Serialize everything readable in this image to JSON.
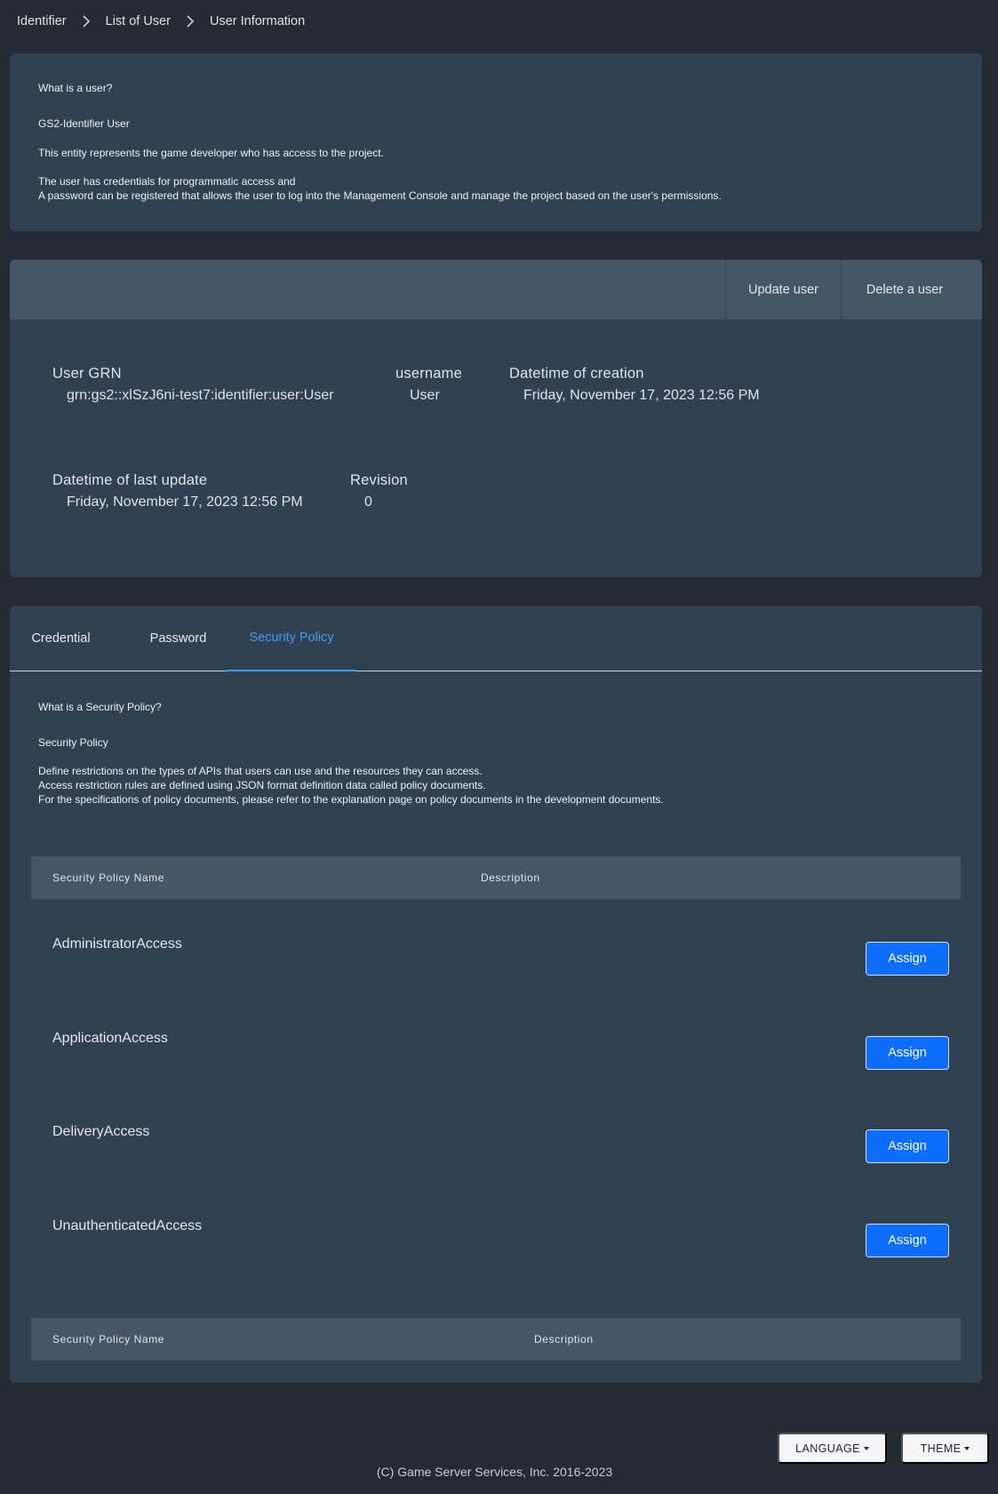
{
  "breadcrumb": {
    "items": [
      "Identifier",
      "List of User",
      "User Information"
    ]
  },
  "user_help": {
    "title": "What is a user?",
    "subtitle": "GS2-Identifier User",
    "p1": "This entity represents the game developer who has access to the project.",
    "p2_line1": "The user has credentials for programmatic access and",
    "p2_line2": "A password can be registered that allows the user to log into the Management Console and manage the project based on the user's permissions."
  },
  "toolbar": {
    "update_label": "Update user",
    "delete_label": "Delete a user"
  },
  "user": {
    "grn_label": "User GRN",
    "grn_value": "grn:gs2::xlSzJ6ni-test7:identifier:user:User",
    "username_label": "username",
    "username_value": "User",
    "created_label": "Datetime of creation",
    "created_value": "Friday, November 17, 2023 12:56 PM",
    "updated_label": "Datetime of last update",
    "updated_value": "Friday, November 17, 2023 12:56 PM",
    "revision_label": "Revision",
    "revision_value": "0"
  },
  "tabs": [
    {
      "label": "Credential",
      "active": false
    },
    {
      "label": "Password",
      "active": false
    },
    {
      "label": "Security Policy",
      "active": true
    }
  ],
  "policy_help": {
    "title": "What is a Security Policy?",
    "subtitle": "Security Policy",
    "line1": "Define restrictions on the types of APIs that users can use and the resources they can access.",
    "line2": "Access restriction rules are defined using JSON format definition data called policy documents.",
    "line3": "For the specifications of policy documents, please refer to the explanation page on policy documents in the development documents."
  },
  "policy_table": {
    "col_name": "Security Policy Name",
    "col_description": "Description",
    "assign_label": "Assign",
    "rows": [
      {
        "name": "AdministratorAccess",
        "description": ""
      },
      {
        "name": "ApplicationAccess",
        "description": ""
      },
      {
        "name": "DeliveryAccess",
        "description": ""
      },
      {
        "name": "UnauthenticatedAccess",
        "description": ""
      }
    ]
  },
  "assigned_table": {
    "col_name": "Security Policy Name",
    "col_description": "Description"
  },
  "footer": {
    "language_label": "LANGUAGE",
    "theme_label": "THEME",
    "copyright": "(C) Game Server Services, Inc. 2016-2023"
  },
  "colors": {
    "background": "#252a33",
    "card": "#324152",
    "header_bar": "#475666",
    "accent": "#3d9df5",
    "primary_button": "#0d6efd"
  }
}
